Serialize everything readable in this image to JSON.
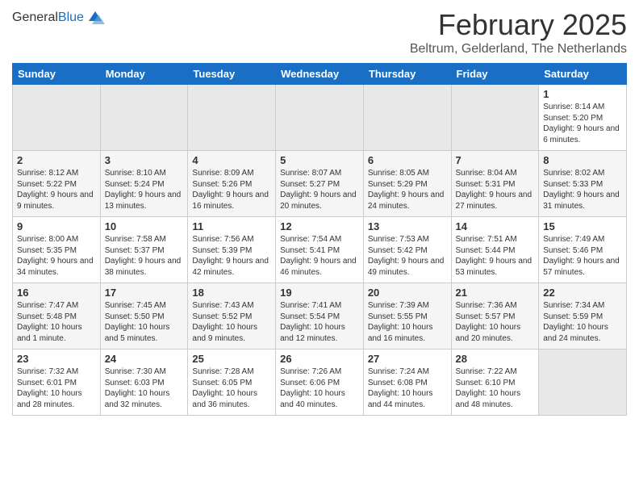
{
  "header": {
    "logo_general": "General",
    "logo_blue": "Blue",
    "month_year": "February 2025",
    "location": "Beltrum, Gelderland, The Netherlands"
  },
  "days_of_week": [
    "Sunday",
    "Monday",
    "Tuesday",
    "Wednesday",
    "Thursday",
    "Friday",
    "Saturday"
  ],
  "weeks": [
    [
      {
        "day": "",
        "info": ""
      },
      {
        "day": "",
        "info": ""
      },
      {
        "day": "",
        "info": ""
      },
      {
        "day": "",
        "info": ""
      },
      {
        "day": "",
        "info": ""
      },
      {
        "day": "",
        "info": ""
      },
      {
        "day": "1",
        "info": "Sunrise: 8:14 AM\nSunset: 5:20 PM\nDaylight: 9 hours and 6 minutes."
      }
    ],
    [
      {
        "day": "2",
        "info": "Sunrise: 8:12 AM\nSunset: 5:22 PM\nDaylight: 9 hours and 9 minutes."
      },
      {
        "day": "3",
        "info": "Sunrise: 8:10 AM\nSunset: 5:24 PM\nDaylight: 9 hours and 13 minutes."
      },
      {
        "day": "4",
        "info": "Sunrise: 8:09 AM\nSunset: 5:26 PM\nDaylight: 9 hours and 16 minutes."
      },
      {
        "day": "5",
        "info": "Sunrise: 8:07 AM\nSunset: 5:27 PM\nDaylight: 9 hours and 20 minutes."
      },
      {
        "day": "6",
        "info": "Sunrise: 8:05 AM\nSunset: 5:29 PM\nDaylight: 9 hours and 24 minutes."
      },
      {
        "day": "7",
        "info": "Sunrise: 8:04 AM\nSunset: 5:31 PM\nDaylight: 9 hours and 27 minutes."
      },
      {
        "day": "8",
        "info": "Sunrise: 8:02 AM\nSunset: 5:33 PM\nDaylight: 9 hours and 31 minutes."
      }
    ],
    [
      {
        "day": "9",
        "info": "Sunrise: 8:00 AM\nSunset: 5:35 PM\nDaylight: 9 hours and 34 minutes."
      },
      {
        "day": "10",
        "info": "Sunrise: 7:58 AM\nSunset: 5:37 PM\nDaylight: 9 hours and 38 minutes."
      },
      {
        "day": "11",
        "info": "Sunrise: 7:56 AM\nSunset: 5:39 PM\nDaylight: 9 hours and 42 minutes."
      },
      {
        "day": "12",
        "info": "Sunrise: 7:54 AM\nSunset: 5:41 PM\nDaylight: 9 hours and 46 minutes."
      },
      {
        "day": "13",
        "info": "Sunrise: 7:53 AM\nSunset: 5:42 PM\nDaylight: 9 hours and 49 minutes."
      },
      {
        "day": "14",
        "info": "Sunrise: 7:51 AM\nSunset: 5:44 PM\nDaylight: 9 hours and 53 minutes."
      },
      {
        "day": "15",
        "info": "Sunrise: 7:49 AM\nSunset: 5:46 PM\nDaylight: 9 hours and 57 minutes."
      }
    ],
    [
      {
        "day": "16",
        "info": "Sunrise: 7:47 AM\nSunset: 5:48 PM\nDaylight: 10 hours and 1 minute."
      },
      {
        "day": "17",
        "info": "Sunrise: 7:45 AM\nSunset: 5:50 PM\nDaylight: 10 hours and 5 minutes."
      },
      {
        "day": "18",
        "info": "Sunrise: 7:43 AM\nSunset: 5:52 PM\nDaylight: 10 hours and 9 minutes."
      },
      {
        "day": "19",
        "info": "Sunrise: 7:41 AM\nSunset: 5:54 PM\nDaylight: 10 hours and 12 minutes."
      },
      {
        "day": "20",
        "info": "Sunrise: 7:39 AM\nSunset: 5:55 PM\nDaylight: 10 hours and 16 minutes."
      },
      {
        "day": "21",
        "info": "Sunrise: 7:36 AM\nSunset: 5:57 PM\nDaylight: 10 hours and 20 minutes."
      },
      {
        "day": "22",
        "info": "Sunrise: 7:34 AM\nSunset: 5:59 PM\nDaylight: 10 hours and 24 minutes."
      }
    ],
    [
      {
        "day": "23",
        "info": "Sunrise: 7:32 AM\nSunset: 6:01 PM\nDaylight: 10 hours and 28 minutes."
      },
      {
        "day": "24",
        "info": "Sunrise: 7:30 AM\nSunset: 6:03 PM\nDaylight: 10 hours and 32 minutes."
      },
      {
        "day": "25",
        "info": "Sunrise: 7:28 AM\nSunset: 6:05 PM\nDaylight: 10 hours and 36 minutes."
      },
      {
        "day": "26",
        "info": "Sunrise: 7:26 AM\nSunset: 6:06 PM\nDaylight: 10 hours and 40 minutes."
      },
      {
        "day": "27",
        "info": "Sunrise: 7:24 AM\nSunset: 6:08 PM\nDaylight: 10 hours and 44 minutes."
      },
      {
        "day": "28",
        "info": "Sunrise: 7:22 AM\nSunset: 6:10 PM\nDaylight: 10 hours and 48 minutes."
      },
      {
        "day": "",
        "info": ""
      }
    ]
  ]
}
